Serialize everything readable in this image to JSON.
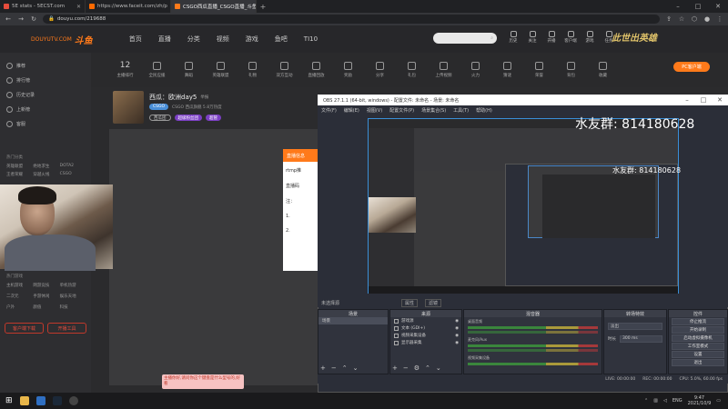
{
  "browser": {
    "tabs": [
      {
        "title": "5E stats - 5ECST.com",
        "color": "#e74c3c"
      },
      {
        "title": "https://www.faceit.com/zh/p",
        "color": "#ff6a00"
      },
      {
        "title": "CSGO西瓜直播_CSGO直播_斗鱼",
        "color": "#ff7a1a"
      }
    ],
    "new_tab": "+",
    "url": "douyu.com/219688"
  },
  "site": {
    "logo_text": "DOUYUTV.COM",
    "logo_brand": "斗鱼",
    "nav": [
      "首页",
      "直播",
      "分类",
      "视频",
      "游戏",
      "鱼吧",
      "TI10"
    ],
    "search_placeholder": "",
    "toolbar_icons": [
      "历史",
      "关注",
      "开播",
      "客户端",
      "游戏",
      "任务"
    ],
    "brand_banner": "此世出英雄",
    "sidebar": {
      "items": [
        "推荐",
        "排行榜",
        "历史记录",
        "上新榜",
        "客服"
      ],
      "group1": "热门分类",
      "grid1": [
        "英雄联盟",
        "绝地求生",
        "DOTA2",
        "王者荣耀",
        "穿越火线",
        "CSGO"
      ],
      "group2": "热门游戏",
      "grid2": [
        "主机游戏",
        "网游竞技",
        "单机热游",
        "二次元",
        "手游休闲",
        "娱乐天地",
        "户外",
        "颜值",
        "科技"
      ],
      "btn_left": "客户端下载",
      "btn_right": "开播工具"
    },
    "categories": [
      {
        "label": "主播排行",
        "num": "12"
      },
      {
        "label": "全民应援"
      },
      {
        "label": "舞蹈"
      },
      {
        "label": "英雄联盟"
      },
      {
        "label": "礼物"
      },
      {
        "label": "双方互动"
      },
      {
        "label": "直播回放"
      },
      {
        "label": "奖励"
      },
      {
        "label": "分享"
      },
      {
        "label": "礼包"
      },
      {
        "label": "上传视频"
      },
      {
        "label": "火力"
      },
      {
        "label": "猜谜"
      },
      {
        "label": "荣誉"
      },
      {
        "label": "背包"
      },
      {
        "label": "收藏"
      }
    ],
    "pc_button": "PC客户端",
    "room": {
      "title": "西瓜：欧洲day5",
      "tag": "举报",
      "meta": "CSGO 西瓜旗舰 5.8万热度",
      "badge1": "西瓜团",
      "badge2": "超级粉丝团",
      "badge3": "超管"
    },
    "popup": {
      "header": "直播信息",
      "line1": "rtmp推",
      "line2": "直播码",
      "line3": "注：",
      "line4": "1.",
      "line5": "2."
    },
    "danmaku": "主播你好,请问你这个键盘是什么型号的,好看"
  },
  "obs": {
    "title": "OBS 27.1.1 (64-bit, windows) - 配置文件: 未命名 - 场景: 未命名",
    "menu": [
      "文件(F)",
      "编辑(E)",
      "视图(V)",
      "配置文件(P)",
      "场景集合(S)",
      "工具(T)",
      "帮助(H)"
    ],
    "overlay_text": "水友群: 814180628",
    "scene_bar": "未选择源",
    "scene_bar_btn1": "属性",
    "scene_bar_btn2": "滤镜",
    "docks": {
      "scenes": {
        "title": "场景",
        "items": [
          "场景"
        ]
      },
      "sources": {
        "title": "来源",
        "items": [
          "游戏源",
          "文本 (GDI+)",
          "视频采集设备",
          "显示器采集"
        ]
      },
      "mixer": {
        "title": "混音器",
        "rows": [
          "桌面音频",
          "麦克风/Aux",
          "视频采集设备"
        ]
      },
      "transitions": {
        "title": "转场特效",
        "type": "淡出",
        "duration_label": "时长",
        "duration": "300 ms"
      },
      "controls": {
        "title": "控件",
        "buttons": [
          "停止推流",
          "开始录制",
          "启动虚拟摄像机",
          "工作室模式",
          "设置",
          "退出"
        ]
      }
    },
    "status": {
      "live": "LIVE: 00:00:00",
      "rec": "REC: 00:00:00",
      "cpu": "CPU: 5.0%, 60.00 fps"
    }
  },
  "taskbar": {
    "lang": "ENG",
    "time": "9:47",
    "date": "2021/10/9"
  }
}
